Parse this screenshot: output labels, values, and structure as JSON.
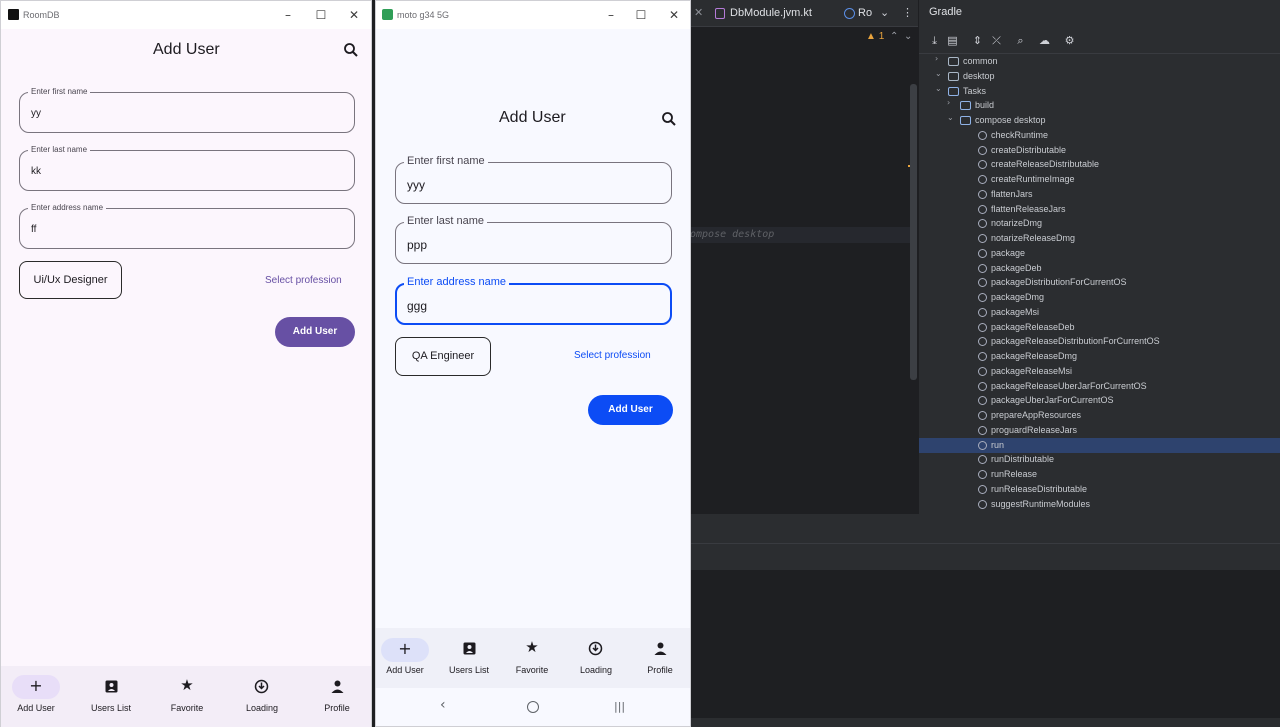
{
  "ide": {
    "tabs": [
      "DbModule.jvm.kt",
      "Ro"
    ],
    "warning_count": "1",
    "code_line": "ompose desktop",
    "gradle": {
      "title": "Gradle",
      "tree": [
        {
          "label": "common",
          "level": 0,
          "kind": "module",
          "expanded": false
        },
        {
          "label": "desktop",
          "level": 0,
          "kind": "module",
          "expanded": true
        },
        {
          "label": "Tasks",
          "level": 1,
          "kind": "folder",
          "expanded": true
        },
        {
          "label": "build",
          "level": 2,
          "kind": "folder",
          "expanded": false
        },
        {
          "label": "compose desktop",
          "level": 2,
          "kind": "folder",
          "expanded": true
        },
        {
          "label": "checkRuntime",
          "level": 3,
          "kind": "task"
        },
        {
          "label": "createDistributable",
          "level": 3,
          "kind": "task"
        },
        {
          "label": "createReleaseDistributable",
          "level": 3,
          "kind": "task"
        },
        {
          "label": "createRuntimeImage",
          "level": 3,
          "kind": "task"
        },
        {
          "label": "flattenJars",
          "level": 3,
          "kind": "task"
        },
        {
          "label": "flattenReleaseJars",
          "level": 3,
          "kind": "task"
        },
        {
          "label": "notarizeDmg",
          "level": 3,
          "kind": "task"
        },
        {
          "label": "notarizeReleaseDmg",
          "level": 3,
          "kind": "task"
        },
        {
          "label": "package",
          "level": 3,
          "kind": "task"
        },
        {
          "label": "packageDeb",
          "level": 3,
          "kind": "task"
        },
        {
          "label": "packageDistributionForCurrentOS",
          "level": 3,
          "kind": "task"
        },
        {
          "label": "packageDmg",
          "level": 3,
          "kind": "task"
        },
        {
          "label": "packageMsi",
          "level": 3,
          "kind": "task"
        },
        {
          "label": "packageReleaseDeb",
          "level": 3,
          "kind": "task"
        },
        {
          "label": "packageReleaseDistributionForCurrentOS",
          "level": 3,
          "kind": "task"
        },
        {
          "label": "packageReleaseDmg",
          "level": 3,
          "kind": "task"
        },
        {
          "label": "packageReleaseMsi",
          "level": 3,
          "kind": "task"
        },
        {
          "label": "packageReleaseUberJarForCurrentOS",
          "level": 3,
          "kind": "task"
        },
        {
          "label": "packageUberJarForCurrentOS",
          "level": 3,
          "kind": "task"
        },
        {
          "label": "prepareAppResources",
          "level": 3,
          "kind": "task"
        },
        {
          "label": "proguardReleaseJars",
          "level": 3,
          "kind": "task"
        },
        {
          "label": "run",
          "level": 3,
          "kind": "task",
          "selected": true
        },
        {
          "label": "runDistributable",
          "level": 3,
          "kind": "task"
        },
        {
          "label": "runRelease",
          "level": 3,
          "kind": "task"
        },
        {
          "label": "runReleaseDistributable",
          "level": 3,
          "kind": "task"
        },
        {
          "label": "suggestRuntimeModules",
          "level": 3,
          "kind": "task"
        }
      ]
    }
  },
  "desktop": {
    "window_title": "RoomDB",
    "page_title": "Add User",
    "fields": {
      "first": {
        "label": "Enter first name",
        "value": "yy"
      },
      "last": {
        "label": "Enter last name",
        "value": "kk"
      },
      "address": {
        "label": "Enter address name",
        "value": "ff"
      }
    },
    "profession_chip": "Ui/Ux Designer",
    "select_profession": "Select profession",
    "add_button": "Add User",
    "accent": "#6750a4",
    "nav": [
      "Add User",
      "Users List",
      "Favorite",
      "Loading",
      "Profile"
    ]
  },
  "phone": {
    "window_title": "moto g34 5G",
    "page_title": "Add User",
    "fields": {
      "first": {
        "label": "Enter first name",
        "value": "yyy"
      },
      "last": {
        "label": "Enter last name",
        "value": "ppp"
      },
      "address": {
        "label": "Enter address name",
        "value": "ggg",
        "focused": true
      }
    },
    "profession_chip": "QA Engineer",
    "select_profession": "Select profession",
    "add_button": "Add User",
    "accent": "#0c4cf5",
    "nav": [
      "Add User",
      "Users List",
      "Favorite",
      "Loading",
      "Profile"
    ]
  }
}
